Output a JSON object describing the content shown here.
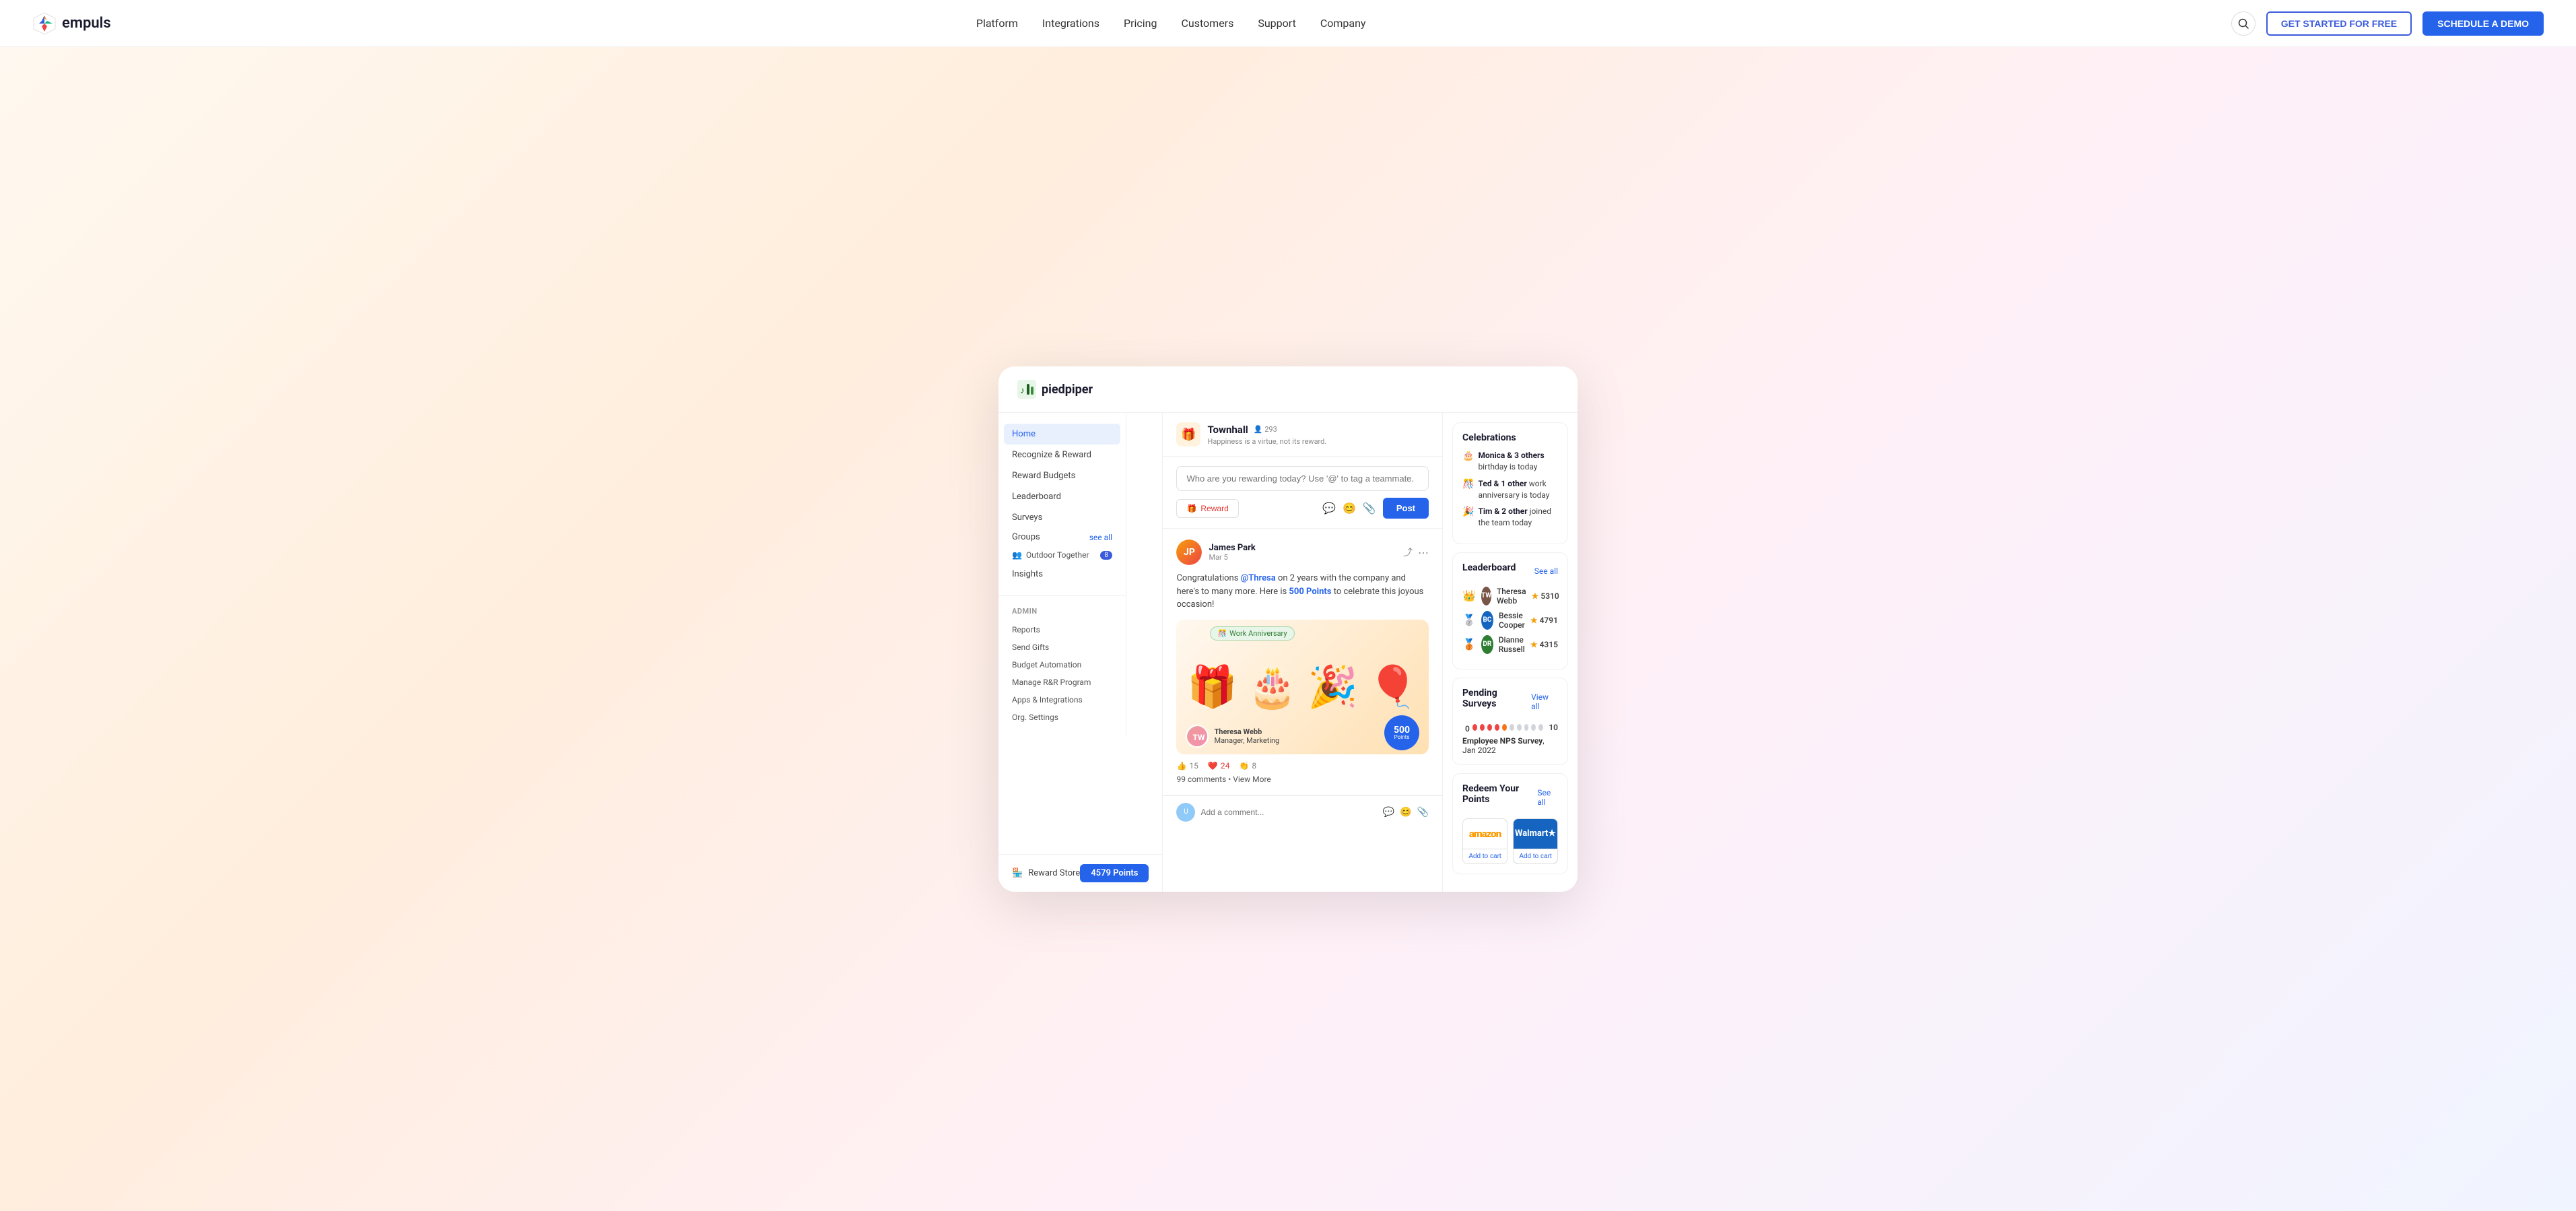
{
  "navbar": {
    "logo_text": "empuls",
    "links": [
      "Platform",
      "Integrations",
      "Pricing",
      "Customers",
      "Support",
      "Company"
    ],
    "btn_outline": "GET STARTED FOR FREE",
    "btn_primary": "SCHEDULE A DEMO"
  },
  "app": {
    "brand_name": "piedpiper",
    "sidebar": {
      "nav_items": [
        "Home",
        "Recognize & Reward",
        "Reward Budgets",
        "Leaderboard",
        "Surveys"
      ],
      "active_item": "Home",
      "groups_label": "Groups",
      "see_all": "see all",
      "group_item": "Outdoor Together",
      "group_badge": "8",
      "insights": "Insights",
      "admin_title": "ADMIN",
      "admin_items": [
        "Reports",
        "Send Gifts",
        "Budget Automation",
        "Manage R&R Program",
        "Apps & Integrations",
        "Org. Settings"
      ]
    },
    "reward_store": {
      "label": "Reward Store",
      "points": "4579 Points"
    },
    "townhall": {
      "icon": "🎁",
      "title": "Townhall",
      "count": "293",
      "subtitle": "Happiness is a virtue, not its reward.",
      "post_placeholder": "Who are you rewarding today? Use '@' to tag a teammate.",
      "btn_reward": "Reward",
      "btn_post": "Post"
    },
    "feed_post": {
      "author": "James Park",
      "date": "Mar 5",
      "text_prefix": "Congratulations ",
      "mention": "@Thresa",
      "text_middle": " on 2 years with the company and here's to many more. Here is ",
      "points_text": "500 Points",
      "text_suffix": " to celebrate this joyous occasion!",
      "badge": "Work Anniversary",
      "theresa_name": "Theresa Webb",
      "theresa_title": "Manager, Marketing",
      "points_amount": "500",
      "points_label": "Points",
      "reactions": {
        "like": "15",
        "heart": "24",
        "clap": "8"
      },
      "comments_text": "99 comments • View More",
      "comment_placeholder": "Add a comment..."
    },
    "celebrations": {
      "title": "Celebrations",
      "items": [
        {
          "icon": "🎂",
          "bold": "Monica & 3 others",
          "text": " birthday is today"
        },
        {
          "icon": "🎊",
          "bold": "Ted & 1 other",
          "text": " work anniversary is today"
        },
        {
          "icon": "🎉",
          "bold": "Tim & 2 other",
          "text": " joined the team today"
        }
      ]
    },
    "leaderboard": {
      "title": "Leaderboard",
      "see_all": "See all",
      "items": [
        {
          "rank_icon": "👑",
          "name": "Theresa Webb",
          "score": "5310",
          "color": "#795548"
        },
        {
          "rank_icon": "🥈",
          "name": "Bessie Cooper",
          "score": "4791",
          "color": "#1565c0"
        },
        {
          "rank_icon": "🥉",
          "name": "Dianne Russell",
          "score": "4315",
          "color": "#2e7d32"
        }
      ]
    },
    "surveys": {
      "title": "Pending Surveys",
      "view_all": "View all",
      "dots": [
        "red",
        "red",
        "red",
        "red",
        "orange",
        "gray",
        "gray",
        "gray",
        "gray",
        "gray"
      ],
      "count": "10",
      "survey_bold": "Employee NPS Survey",
      "survey_date": ", Jan 2022"
    },
    "redeem": {
      "title": "Redeem Your Points",
      "see_all": "See all",
      "stores": [
        {
          "name": "amazon",
          "logo": "amazon",
          "cart": "Add to cart"
        },
        {
          "name": "walmart",
          "logo": "Walmart★",
          "cart": "Add to cart"
        }
      ]
    }
  }
}
